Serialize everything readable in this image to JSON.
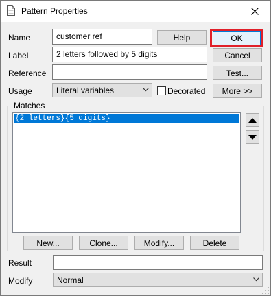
{
  "window": {
    "title": "Pattern Properties"
  },
  "form": {
    "name_label": "Name",
    "name_value": "customer ref",
    "label_label": "Label",
    "label_value": "2 letters followed by 5 digits",
    "reference_label": "Reference",
    "reference_value": "",
    "usage_label": "Usage",
    "usage_value": "Literal variables",
    "decorated_label": "Decorated",
    "decorated_checked": false,
    "result_label": "Result",
    "result_value": "",
    "modify_label": "Modify",
    "modify_value": "Normal"
  },
  "buttons": {
    "help": "Help",
    "ok": "OK",
    "cancel": "Cancel",
    "test": "Test...",
    "more": "More >>",
    "new": "New...",
    "clone": "Clone...",
    "modify": "Modify...",
    "delete": "Delete"
  },
  "matches": {
    "group_label": "Matches",
    "items": [
      "{2 letters}{5 digits}"
    ]
  },
  "colors": {
    "selection": "#0078d7",
    "ok_highlight": "#e0202a",
    "window_bg": "#f0f0f0"
  }
}
